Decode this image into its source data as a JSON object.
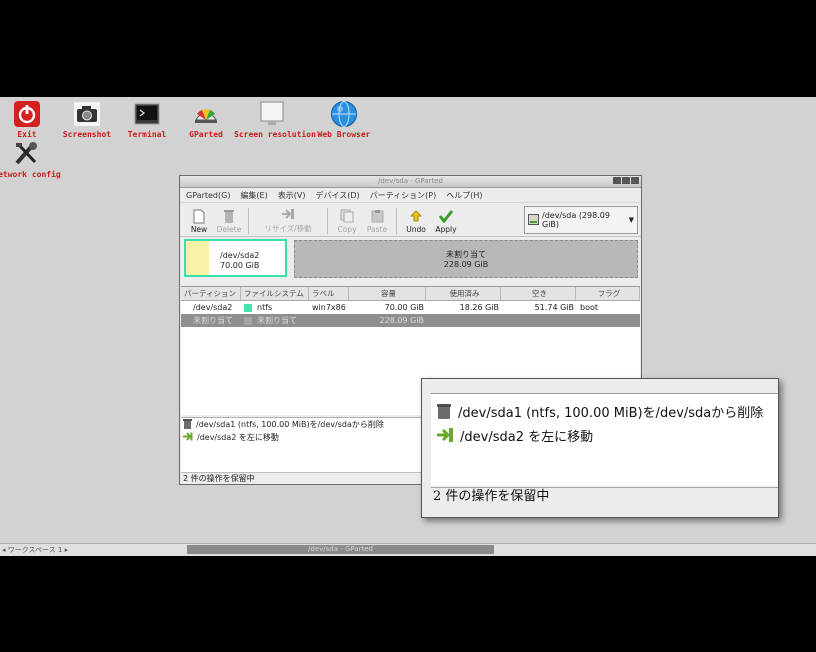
{
  "desktop_icons": [
    {
      "label": "Exit",
      "icon": "power-icon"
    },
    {
      "label": "Screenshot",
      "icon": "camera-icon"
    },
    {
      "label": "Terminal",
      "icon": "terminal-icon"
    },
    {
      "label": "GParted",
      "icon": "gparted-icon"
    },
    {
      "label": "Screen resolution",
      "icon": "monitor-icon"
    },
    {
      "label": "Web Browser",
      "icon": "globe-icon"
    },
    {
      "label": "Network config",
      "icon": "tools-icon"
    }
  ],
  "window": {
    "title": "/dev/sda - GParted",
    "menu": [
      "GParted(G)",
      "編集(E)",
      "表示(V)",
      "デバイス(D)",
      "パーティション(P)",
      "ヘルプ(H)"
    ],
    "toolbar": {
      "new": "New",
      "delete": "Delete",
      "resize": "リサイズ/移動",
      "copy": "Copy",
      "paste": "Paste",
      "undo": "Undo",
      "apply": "Apply"
    },
    "device": "/dev/sda  (298.09 GiB)"
  },
  "disk_map": {
    "p1_name": "/dev/sda2",
    "p1_size": "70.00 GiB",
    "unalloc_name": "未割り当て",
    "unalloc_size": "228.09 GiB"
  },
  "table": {
    "headers": [
      "パーティション",
      "ファイルシステム",
      "ラベル",
      "容量",
      "使用済み",
      "空き",
      "フラグ"
    ],
    "rows": [
      {
        "partition": "/dev/sda2",
        "fs": "ntfs",
        "label": "win7x86",
        "size": "70.00 GiB",
        "used": "18.26 GiB",
        "free": "51.74 GiB",
        "flags": "boot",
        "fs_color": "#42e5ac"
      },
      {
        "partition": "未割り当て",
        "fs": "未割り当て",
        "label": "",
        "size": "228.09 GiB",
        "used": "",
        "free": "",
        "flags": "",
        "fs_color": "#a6a6a6"
      }
    ]
  },
  "pending": [
    "/dev/sda1 (ntfs, 100.00 MiB)を/dev/sdaから削除",
    "/dev/sda2 を左に移動"
  ],
  "status": "2 件の操作を保留中",
  "taskbar": {
    "workspace": "◂ ワークスペース 1 ▸",
    "task": "/dev/sda - GParted"
  },
  "colors": {
    "accent": "#3ae0a9",
    "unallocated": "#b8b8b8",
    "desktop_label": "#d01818"
  }
}
